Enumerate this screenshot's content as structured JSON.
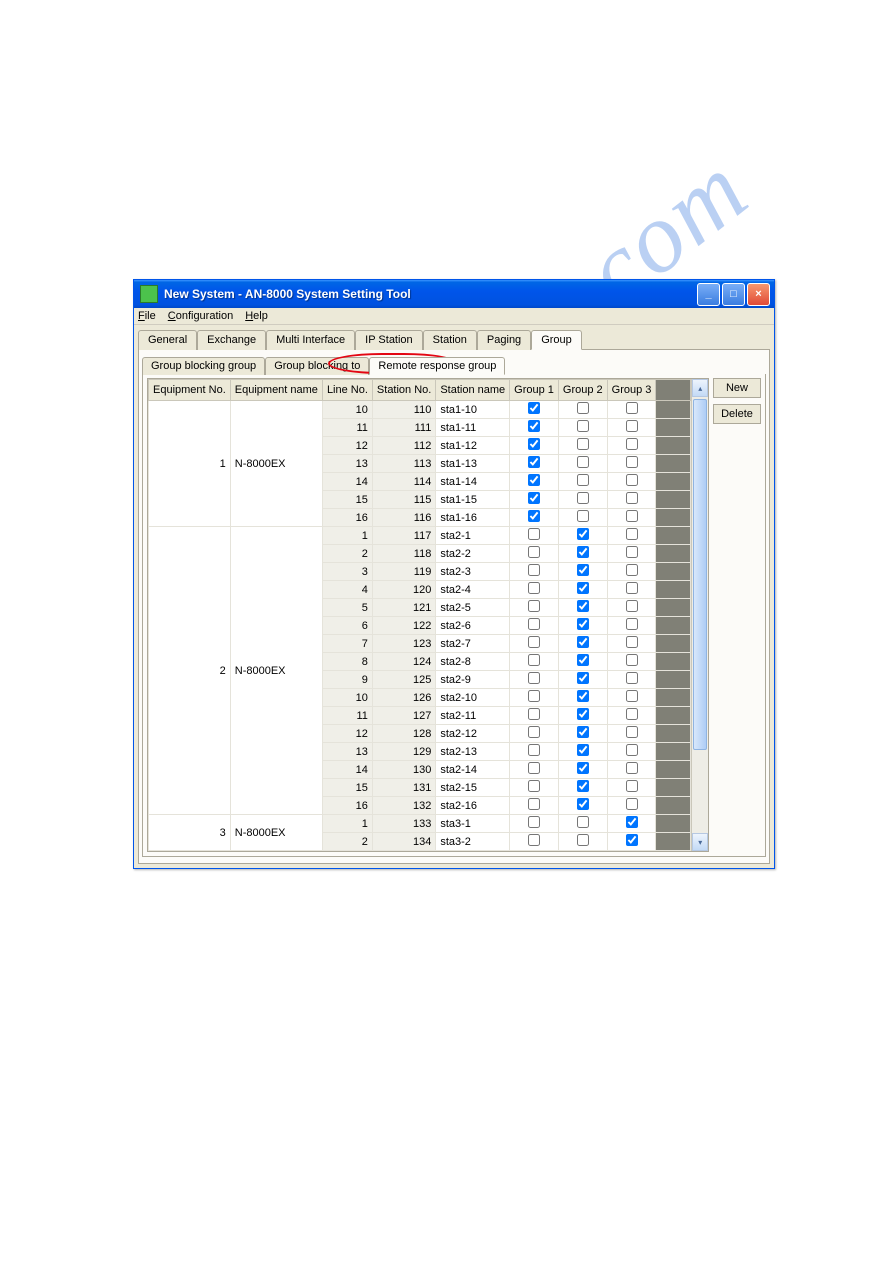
{
  "window": {
    "title": "New System - AN-8000 System Setting Tool"
  },
  "menubar": {
    "file": "File",
    "configuration": "Configuration",
    "help": "Help"
  },
  "maintabs": {
    "general": "General",
    "exchange": "Exchange",
    "multi": "Multi Interface",
    "ip": "IP Station",
    "station": "Station",
    "paging": "Paging",
    "group": "Group"
  },
  "subtabs": {
    "gbg": "Group blocking group",
    "gbt": "Group blocking to",
    "rrg": "Remote response group"
  },
  "table": {
    "headers": {
      "eqno": "Equipment No.",
      "eqname": "Equipment name",
      "lineno": "Line No.",
      "stno": "Station No.",
      "stname": "Station name",
      "g1": "Group 1",
      "g2": "Group 2",
      "g3": "Group 3"
    },
    "groups": [
      {
        "eqno": "1",
        "eqname": "N-8000EX",
        "rows": [
          {
            "line": "10",
            "stno": "110",
            "stname": "sta1-10",
            "g1": true,
            "g2": false,
            "g3": false
          },
          {
            "line": "11",
            "stno": "111",
            "stname": "sta1-11",
            "g1": true,
            "g2": false,
            "g3": false
          },
          {
            "line": "12",
            "stno": "112",
            "stname": "sta1-12",
            "g1": true,
            "g2": false,
            "g3": false
          },
          {
            "line": "13",
            "stno": "113",
            "stname": "sta1-13",
            "g1": true,
            "g2": false,
            "g3": false
          },
          {
            "line": "14",
            "stno": "114",
            "stname": "sta1-14",
            "g1": true,
            "g2": false,
            "g3": false
          },
          {
            "line": "15",
            "stno": "115",
            "stname": "sta1-15",
            "g1": true,
            "g2": false,
            "g3": false
          },
          {
            "line": "16",
            "stno": "116",
            "stname": "sta1-16",
            "g1": true,
            "g2": false,
            "g3": false
          }
        ]
      },
      {
        "eqno": "2",
        "eqname": "N-8000EX",
        "rows": [
          {
            "line": "1",
            "stno": "117",
            "stname": "sta2-1",
            "g1": false,
            "g2": true,
            "g3": false
          },
          {
            "line": "2",
            "stno": "118",
            "stname": "sta2-2",
            "g1": false,
            "g2": true,
            "g3": false
          },
          {
            "line": "3",
            "stno": "119",
            "stname": "sta2-3",
            "g1": false,
            "g2": true,
            "g3": false
          },
          {
            "line": "4",
            "stno": "120",
            "stname": "sta2-4",
            "g1": false,
            "g2": true,
            "g3": false
          },
          {
            "line": "5",
            "stno": "121",
            "stname": "sta2-5",
            "g1": false,
            "g2": true,
            "g3": false
          },
          {
            "line": "6",
            "stno": "122",
            "stname": "sta2-6",
            "g1": false,
            "g2": true,
            "g3": false
          },
          {
            "line": "7",
            "stno": "123",
            "stname": "sta2-7",
            "g1": false,
            "g2": true,
            "g3": false
          },
          {
            "line": "8",
            "stno": "124",
            "stname": "sta2-8",
            "g1": false,
            "g2": true,
            "g3": false
          },
          {
            "line": "9",
            "stno": "125",
            "stname": "sta2-9",
            "g1": false,
            "g2": true,
            "g3": false
          },
          {
            "line": "10",
            "stno": "126",
            "stname": "sta2-10",
            "g1": false,
            "g2": true,
            "g3": false
          },
          {
            "line": "11",
            "stno": "127",
            "stname": "sta2-11",
            "g1": false,
            "g2": true,
            "g3": false
          },
          {
            "line": "12",
            "stno": "128",
            "stname": "sta2-12",
            "g1": false,
            "g2": true,
            "g3": false
          },
          {
            "line": "13",
            "stno": "129",
            "stname": "sta2-13",
            "g1": false,
            "g2": true,
            "g3": false
          },
          {
            "line": "14",
            "stno": "130",
            "stname": "sta2-14",
            "g1": false,
            "g2": true,
            "g3": false
          },
          {
            "line": "15",
            "stno": "131",
            "stname": "sta2-15",
            "g1": false,
            "g2": true,
            "g3": false
          },
          {
            "line": "16",
            "stno": "132",
            "stname": "sta2-16",
            "g1": false,
            "g2": true,
            "g3": false
          }
        ]
      },
      {
        "eqno": "3",
        "eqname": "N-8000EX",
        "rows": [
          {
            "line": "1",
            "stno": "133",
            "stname": "sta3-1",
            "g1": false,
            "g2": false,
            "g3": true
          },
          {
            "line": "2",
            "stno": "134",
            "stname": "sta3-2",
            "g1": false,
            "g2": false,
            "g3": true
          }
        ]
      }
    ]
  },
  "buttons": {
    "new": "New",
    "delete": "Delete"
  },
  "watermark": "manualhive.com"
}
